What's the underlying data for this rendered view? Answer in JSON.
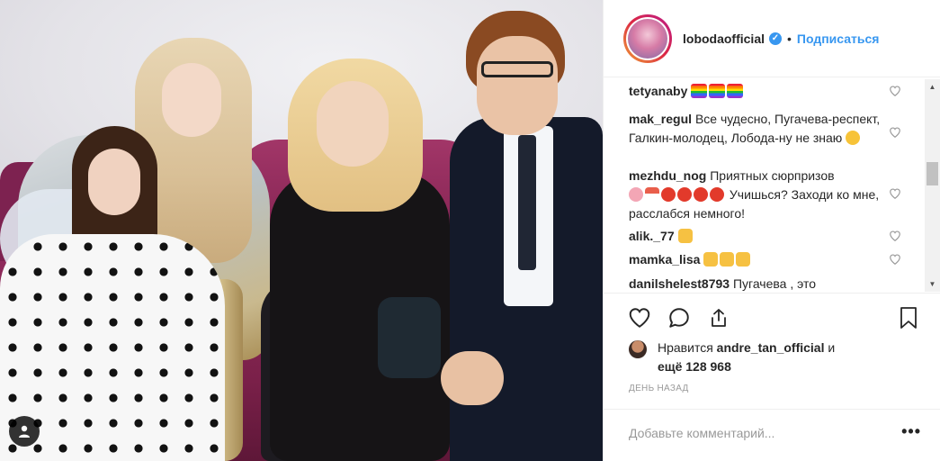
{
  "post": {
    "username": "lobodaofficial",
    "follow_label": "Подписаться",
    "separator": "•"
  },
  "comments": [
    {
      "user": "tetyanaby",
      "text": "",
      "emojis": [
        "flag",
        "flag",
        "flag"
      ]
    },
    {
      "user": "mak_regul",
      "text": "Все чудесно, Пугачева-респект, Галкин-молодец, Лобода-ну не знаю",
      "emojis_after": [
        "thinking"
      ]
    },
    {
      "user": "mezhdu_nog",
      "text": "Приятных сюрпризов",
      "line2_text": "Учишься? Заходи ко мне, расслабся немного!",
      "emojis": [
        "brain",
        "sushi",
        "tomato",
        "tomato",
        "tomato",
        "tomato"
      ]
    },
    {
      "user": "alik._77",
      "text": "",
      "emojis": [
        "thumb"
      ]
    },
    {
      "user": "mamka_lisa",
      "text": "",
      "emojis": [
        "thumb",
        "thumb",
        "thumb"
      ]
    },
    {
      "user": "danilshelest8793",
      "text": "Пугачева , это"
    }
  ],
  "likes": {
    "prefix": "Нравится",
    "user": "andre_tan_official",
    "conj": "и",
    "more": "ещё 128 968"
  },
  "time_ago": "ДЕНЬ НАЗАД",
  "add_comment": {
    "placeholder": "Добавьте комментарий..."
  },
  "more_label": "•••",
  "icons": {
    "heart": "heart-icon",
    "comment": "comment-icon",
    "share": "share-icon",
    "bookmark": "bookmark-icon",
    "verified": "verified-icon",
    "user": "user-icon"
  },
  "colors": {
    "link": "#3897f0",
    "text": "#262626",
    "muted": "#999999",
    "border": "#efefef"
  }
}
